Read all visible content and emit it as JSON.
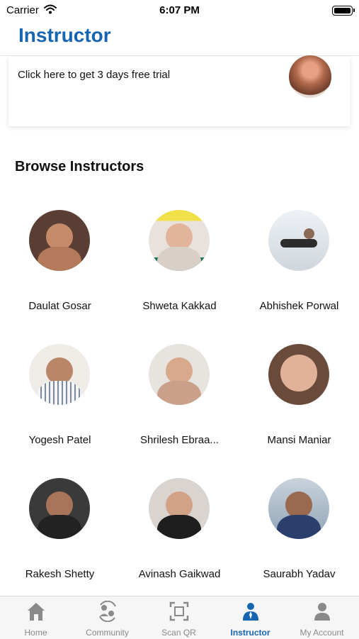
{
  "status_bar": {
    "carrier": "Carrier",
    "time": "6:07 PM"
  },
  "header": {
    "title": "Instructor"
  },
  "trial": {
    "text": "Click here to get 3 days free trial"
  },
  "browse": {
    "title": "Browse Instructors",
    "instructors": [
      {
        "name": "Daulat Gosar"
      },
      {
        "name": "Shweta Kakkad"
      },
      {
        "name": "Abhishek Porwal"
      },
      {
        "name": "Yogesh Patel"
      },
      {
        "name": "Shrilesh Ebraa..."
      },
      {
        "name": "Mansi Maniar"
      },
      {
        "name": "Rakesh  Shetty"
      },
      {
        "name": "Avinash Gaikwad"
      },
      {
        "name": "Saurabh Yadav"
      }
    ]
  },
  "tab_bar": {
    "tabs": [
      {
        "label": "Home",
        "icon": "home-icon"
      },
      {
        "label": "Community",
        "icon": "community-icon"
      },
      {
        "label": "Scan QR",
        "icon": "scan-qr-icon"
      },
      {
        "label": "Instructor",
        "icon": "instructor-icon",
        "active": true
      },
      {
        "label": "My Account",
        "icon": "account-icon"
      }
    ],
    "active_color": "#1565b0",
    "inactive_color": "#8a8a8a"
  },
  "colors": {
    "brand": "#1565b0"
  }
}
